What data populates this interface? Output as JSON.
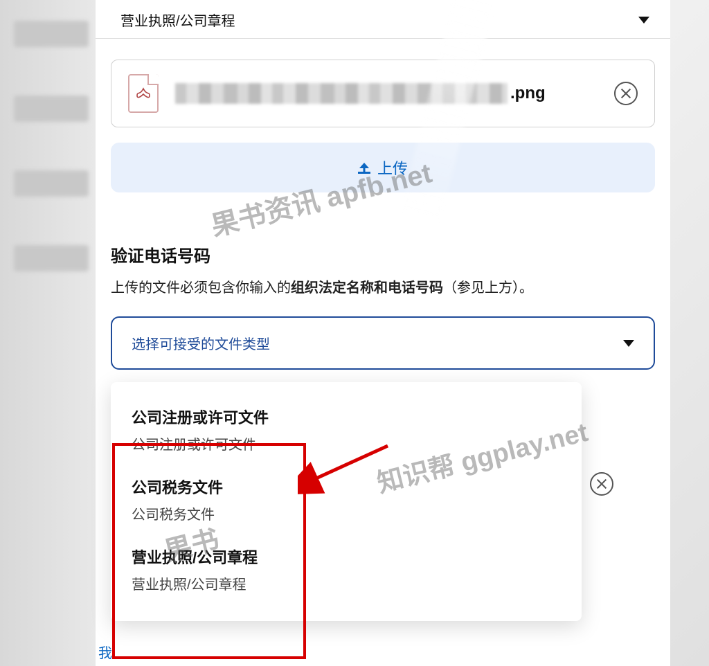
{
  "top_select": {
    "label": "营业执照/公司章程"
  },
  "uploaded_file": {
    "extension": ".png"
  },
  "upload_button": {
    "label": "上传"
  },
  "verify_section": {
    "title": "验证电话号码",
    "desc_prefix": "上传的文件必须包含你输入的",
    "desc_strong": "组织法定名称和电话号码",
    "desc_suffix": "（参见上方）。"
  },
  "file_type_select": {
    "placeholder": "选择可接受的文件类型",
    "options": [
      {
        "title": "公司注册或许可文件",
        "sub": "公司注册或许可文件"
      },
      {
        "title": "公司税务文件",
        "sub": "公司税务文件"
      },
      {
        "title": "营业执照/公司章程",
        "sub": "营业执照/公司章程"
      }
    ]
  },
  "footer": {
    "link_prefix": "我"
  },
  "watermarks": {
    "wm1": "果书资讯 apfb.net",
    "wm2": "知识帮 ggplay.net",
    "wm3": "果书"
  }
}
